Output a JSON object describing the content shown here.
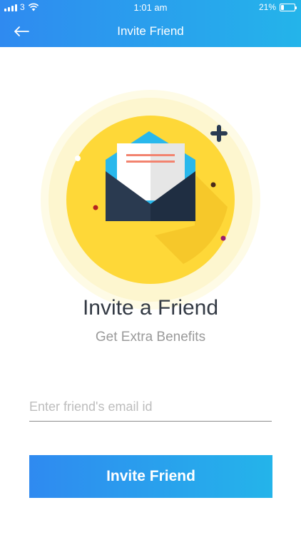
{
  "status_bar": {
    "carrier": "3",
    "time": "1:01 am",
    "battery_percent": "21%",
    "battery_level": 0.21,
    "icons": [
      "signal-icon",
      "wifi-icon",
      "battery-icon"
    ]
  },
  "nav": {
    "back_icon": "arrow-left-icon",
    "title": "Invite Friend"
  },
  "illustration": {
    "icon": "envelope-letter-icon",
    "colors": {
      "halo": "#fdf8d8",
      "circle": "#fed838",
      "envelope": "#243447",
      "letter": "#eeeeee",
      "letter_lines": "#f2836f",
      "envelope_top": "#29b8ec",
      "plus": "#2a3b52"
    }
  },
  "content": {
    "title": "Invite a Friend",
    "subtitle": "Get Extra Benefits"
  },
  "form": {
    "email_placeholder": "Enter friend's email id",
    "email_value": ""
  },
  "actions": {
    "invite_label": "Invite Friend"
  },
  "colors": {
    "gradient_start": "#2f8af0",
    "gradient_end": "#24b4ea"
  }
}
